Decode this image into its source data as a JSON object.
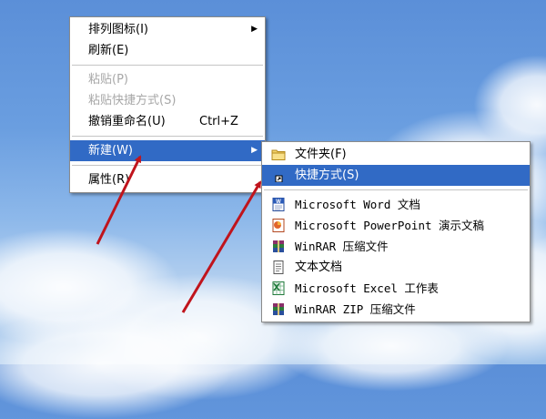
{
  "context_menu": {
    "items": [
      {
        "label": "排列图标(I)",
        "has_submenu": true
      },
      {
        "label": "刷新(E)"
      },
      {
        "separator": true
      },
      {
        "label": "粘贴(P)",
        "disabled": true
      },
      {
        "label": "粘贴快捷方式(S)",
        "disabled": true
      },
      {
        "label": "撤销重命名(U)",
        "shortcut": "Ctrl+Z"
      },
      {
        "separator": true
      },
      {
        "label": "新建(W)",
        "has_submenu": true,
        "highlighted": true
      },
      {
        "separator": true
      },
      {
        "label": "属性(R)"
      }
    ]
  },
  "new_submenu": {
    "items": [
      {
        "label": "文件夹(F)",
        "icon": "folder-icon"
      },
      {
        "label": "快捷方式(S)",
        "icon": "shortcut-icon",
        "highlighted": true
      },
      {
        "separator": true
      },
      {
        "label": "Microsoft Word 文档",
        "icon": "word-icon"
      },
      {
        "label": "Microsoft PowerPoint 演示文稿",
        "icon": "powerpoint-icon"
      },
      {
        "label": "WinRAR 压缩文件",
        "icon": "winrar-icon"
      },
      {
        "label": "文本文档",
        "icon": "text-document-icon"
      },
      {
        "label": "Microsoft Excel 工作表",
        "icon": "excel-icon"
      },
      {
        "label": "WinRAR ZIP 压缩文件",
        "icon": "winrar-zip-icon"
      }
    ]
  },
  "colors": {
    "highlight": "#316ac5",
    "arrow": "#c0141c",
    "desktop_sky": "#5b8fd8"
  }
}
